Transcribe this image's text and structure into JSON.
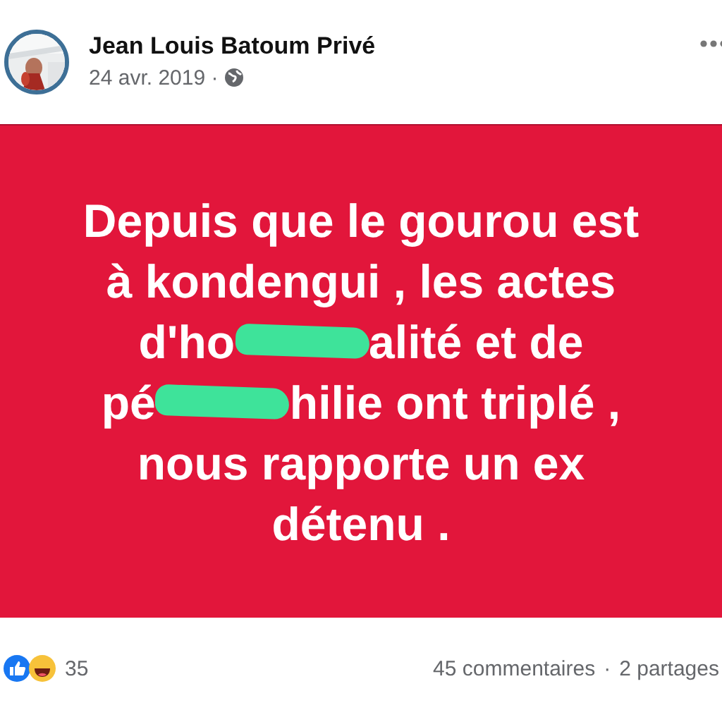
{
  "author": {
    "name": "Jean Louis Batoum Privé",
    "date": "24 avr. 2019 ·"
  },
  "post": {
    "lines": [
      [
        {
          "kind": "text",
          "text": "Depuis que le gourou est"
        }
      ],
      [
        {
          "kind": "text",
          "text": "à kondengui , les actes"
        }
      ],
      [
        {
          "kind": "text",
          "text": "d'ho"
        },
        {
          "kind": "redaction"
        },
        {
          "kind": "text",
          "text": "alité et de"
        }
      ],
      [
        {
          "kind": "text",
          "text": "pé"
        },
        {
          "kind": "redaction"
        },
        {
          "kind": "text",
          "text": "hilie ont triplé ,"
        }
      ],
      [
        {
          "kind": "text",
          "text": "nous rapporte un ex"
        }
      ],
      [
        {
          "kind": "text",
          "text": "détenu ."
        }
      ]
    ]
  },
  "footer": {
    "reaction_count": "35",
    "comments": "45 commentaires",
    "separator": "·",
    "shares": "2 partages"
  }
}
